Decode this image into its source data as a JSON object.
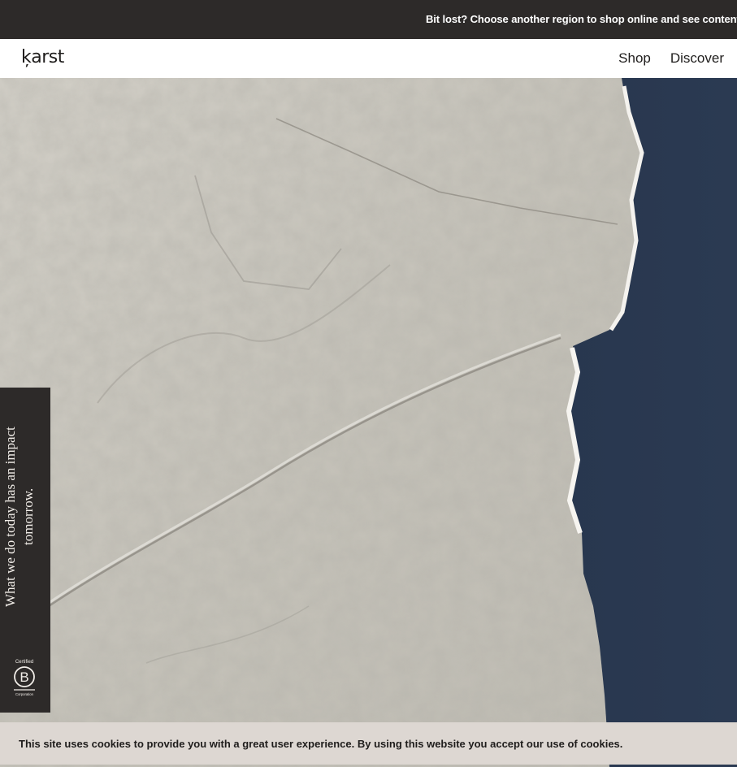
{
  "announcement": {
    "text": "Bit lost? Choose another region to shop online and see content"
  },
  "header": {
    "logo": "ķarst",
    "nav": [
      "Shop",
      "Discover"
    ]
  },
  "hero": {
    "image": "white chalky stone surface against dark navy background"
  },
  "side_tab": {
    "tagline": "What we do today has an impact tomorrow.",
    "badge_top": "Certified",
    "badge_letter": "B",
    "badge_bottom": "Corporation"
  },
  "cookie_banner": {
    "text": "This site uses cookies to provide you with a great user experience. By using this website you accept our use of cookies."
  },
  "colors": {
    "dark": "#2d2a29",
    "stone": "#c9c6bd",
    "navy": "#26344b",
    "cookie_bg": "#ddd7d2"
  }
}
